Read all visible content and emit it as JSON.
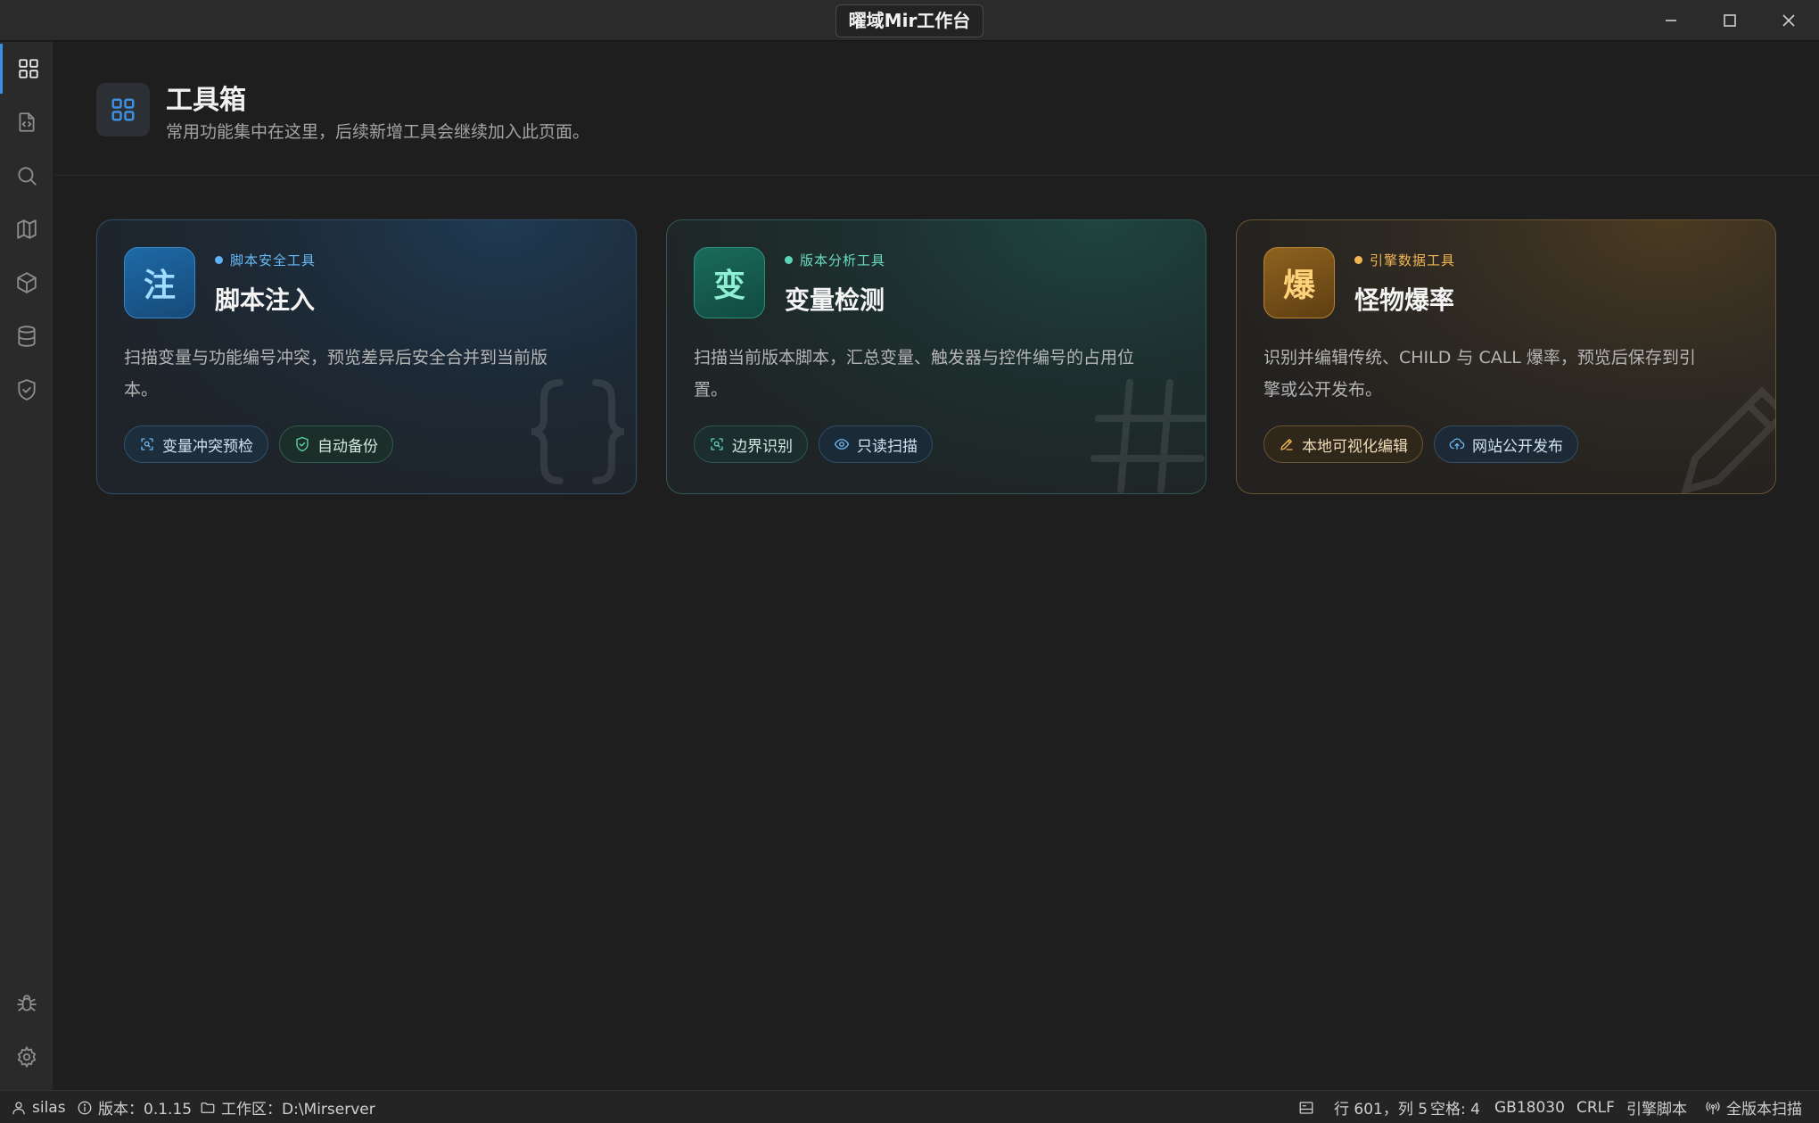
{
  "window": {
    "title": "曜域Mir工作台",
    "controls": {
      "minimize": "minimize-icon",
      "maximize": "maximize-icon",
      "close": "close-icon"
    }
  },
  "activity_bar": {
    "top": [
      "grid-icon",
      "file-code-icon",
      "search-icon",
      "map-icon",
      "box-icon",
      "database-icon",
      "shield-check-icon"
    ],
    "bottom": [
      "bug-icon",
      "gear-icon"
    ],
    "active": "grid-icon"
  },
  "header": {
    "icon": "grid-icon",
    "title": "工具箱",
    "subtitle": "常用功能集中在这里，后续新增工具会继续加入此页面。"
  },
  "cards": [
    {
      "badge": "注",
      "tag": "脚本安全工具",
      "title": "脚本注入",
      "desc": "扫描变量与功能编号冲突，预览差异后安全合并到当前版本。",
      "chips": [
        {
          "label": "变量冲突预检",
          "icon": "scan-icon"
        },
        {
          "label": "自动备份",
          "icon": "shield-check-icon"
        }
      ],
      "accent": "#5fb2f3"
    },
    {
      "badge": "变",
      "tag": "版本分析工具",
      "title": "变量检测",
      "desc": "扫描当前版本脚本，汇总变量、触发器与控件编号的占用位置。",
      "chips": [
        {
          "label": "边界识别",
          "icon": "scan-icon"
        },
        {
          "label": "只读扫描",
          "icon": "eye-icon"
        }
      ],
      "accent": "#5dd6b8"
    },
    {
      "badge": "爆",
      "tag": "引擎数据工具",
      "title": "怪物爆率",
      "desc": "识别并编辑传统、CHILD 与 CALL 爆率，预览后保存到引擎或公开发布。",
      "chips": [
        {
          "label": "本地可视化编辑",
          "icon": "pencil-icon"
        },
        {
          "label": "网站公开发布",
          "icon": "cloud-upload-icon"
        }
      ],
      "accent": "#f2b553"
    }
  ],
  "status_bar": {
    "user": "silas",
    "version": "版本：0.1.15",
    "workspace": "工作区：D:\\Mirserver",
    "position": "行 601，列 5",
    "indent": "空格: 4",
    "encoding": "GB18030",
    "eol": "CRLF",
    "language": "引擎脚本",
    "scan": "全版本扫描"
  }
}
